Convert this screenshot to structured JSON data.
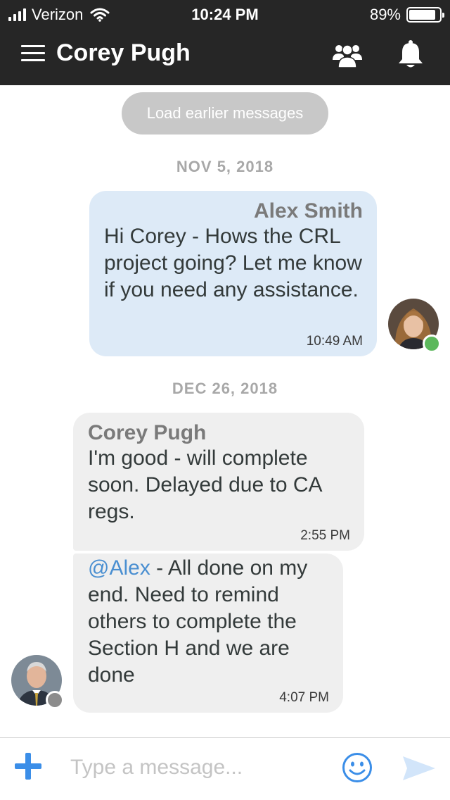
{
  "status_bar": {
    "carrier": "Verizon",
    "time": "10:24 PM",
    "battery_pct": "89%",
    "battery_level": 0.89
  },
  "nav": {
    "title": "Corey Pugh",
    "icons": [
      "menu-icon",
      "group-icon",
      "bell-icon"
    ]
  },
  "chat": {
    "load_earlier": "Load earlier messages",
    "groups": [
      {
        "date": "NOV 5, 2018",
        "messages": [
          {
            "sender": "Alex Smith",
            "text": "Hi Corey - Hows the CRL project going? Let me know if you need any assistance.",
            "time": "10:49 AM",
            "status": "online"
          }
        ]
      },
      {
        "date": "DEC 26, 2018",
        "messages": [
          {
            "sender": "Corey Pugh",
            "text": "I'm good - will complete soon.  Delayed due to CA regs.",
            "time": "2:55 PM"
          },
          {
            "mention": "@Alex",
            "text": " - All done on my end.  Need to remind others to complete the Section H and we are done",
            "time": "4:07 PM",
            "status": "offline"
          }
        ]
      }
    ]
  },
  "composer": {
    "placeholder": "Type a message...",
    "value": ""
  },
  "colors": {
    "header_bg": "#262626",
    "sent_bubble": "#ddeaf7",
    "received_bubble": "#efefef",
    "accent": "#3b8ee8",
    "online": "#5cb85c",
    "offline": "#8c8c8c"
  }
}
